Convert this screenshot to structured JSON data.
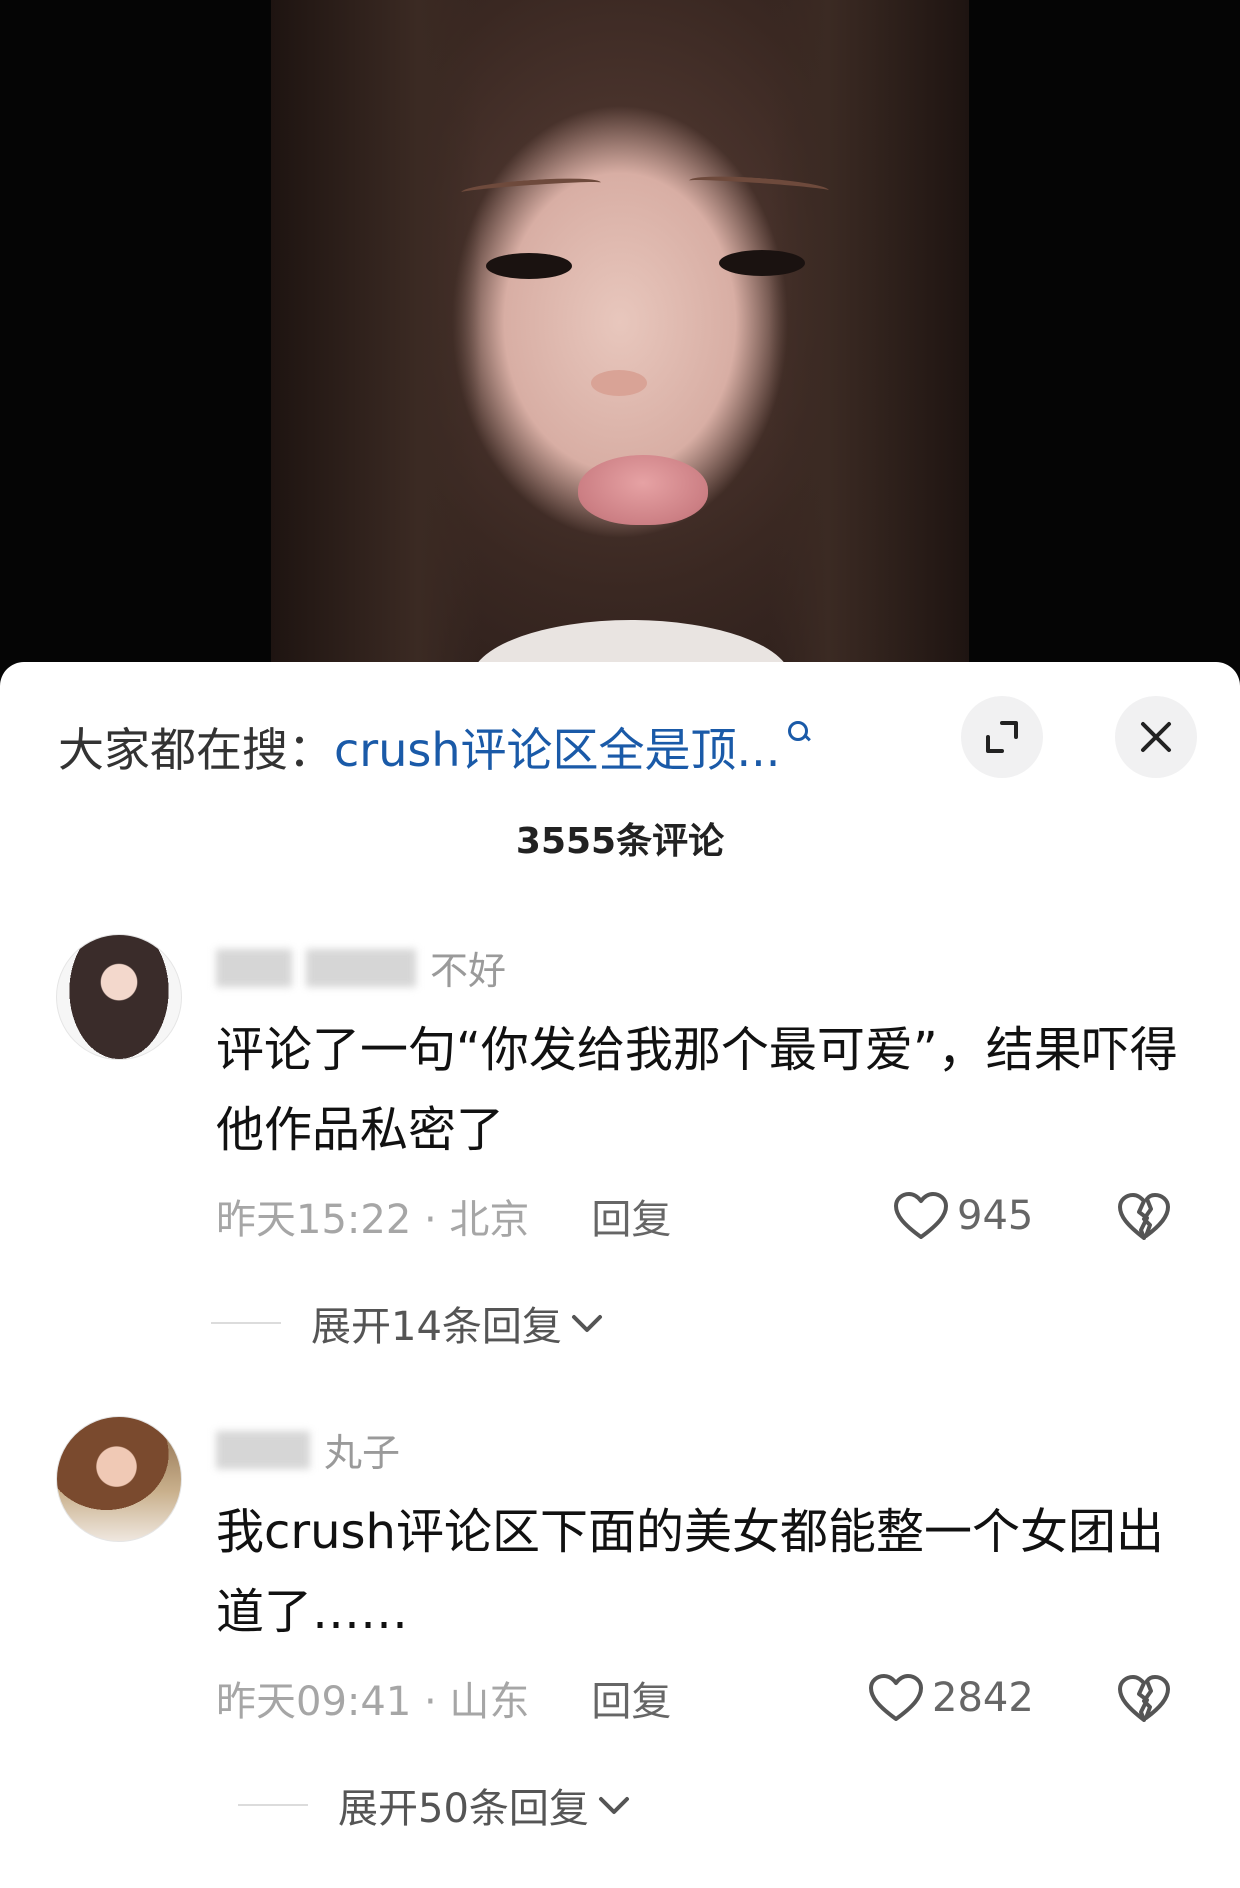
{
  "search": {
    "prefix": "大家都在搜：",
    "query": "crush评论区全是顶..."
  },
  "comments_header": {
    "count_label": "3555条评论"
  },
  "comments": [
    {
      "username_visible": "不好",
      "text": "评论了一句“你发给我那个最可爱”，结果吓得他作品私密了",
      "time_location": "昨天15:22 · 北京",
      "reply_label": "回复",
      "likes": "945",
      "expand_label": "展开14条回复"
    },
    {
      "username_visible": "丸子",
      "text": "我crush评论区下面的美女都能整一个女团出道了……",
      "time_location": "昨天09:41 · 山东",
      "reply_label": "回复",
      "likes": "2842",
      "expand_label": "展开50条回复"
    }
  ],
  "colors": {
    "search_query": "#1a5aa8",
    "meta_gray": "#a6a6a6",
    "sheet_bg": "#ffffff"
  },
  "icons": {
    "search": "search-icon",
    "expand": "expand-icon",
    "close": "close-icon",
    "like": "heart-icon",
    "dislike": "broken-heart-icon",
    "chevron": "chevron-down-icon"
  }
}
